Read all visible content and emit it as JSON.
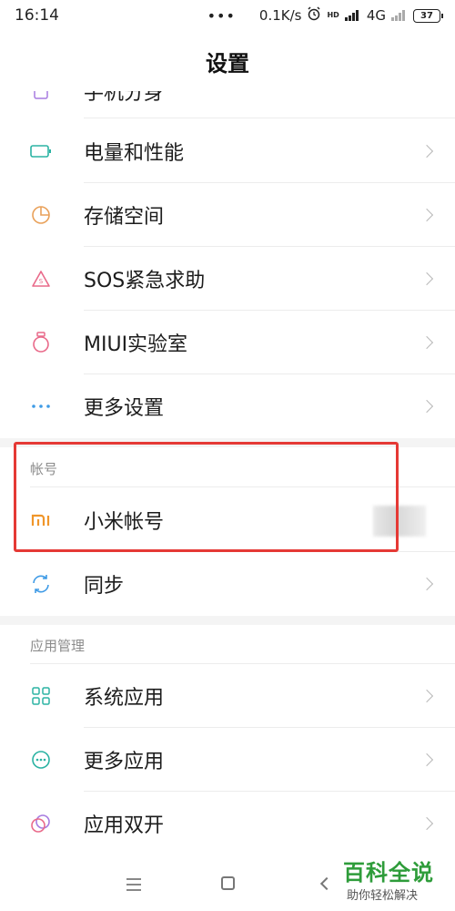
{
  "status_bar": {
    "time": "16:14",
    "dots": "•••",
    "net_speed": "0.1K/s",
    "alarm_icon": "alarm-icon",
    "hd_label": "HD",
    "network": "4G",
    "battery": "37"
  },
  "header": {
    "title": "设置"
  },
  "partial_item": {
    "label": "手机分身",
    "icon": "dual-phone-icon"
  },
  "items_top": [
    {
      "label": "电量和性能",
      "icon": "battery-icon",
      "color": "#2bb3a3"
    },
    {
      "label": "存储空间",
      "icon": "storage-pie-icon",
      "color": "#e9a15a"
    },
    {
      "label": "SOS紧急求助",
      "icon": "sos-icon",
      "color": "#e96a8a"
    },
    {
      "label": "MIUI实验室",
      "icon": "lab-flask-icon",
      "color": "#e96a8a"
    },
    {
      "label": "更多设置",
      "icon": "more-dots-icon",
      "color": "#3f9be6"
    }
  ],
  "account_section": {
    "header": "帐号",
    "items": [
      {
        "label": "小米帐号",
        "icon": "mi-logo-icon",
        "color": "#f0962a"
      },
      {
        "label": "同步",
        "icon": "sync-icon",
        "color": "#3f9be6"
      }
    ]
  },
  "apps_section": {
    "header": "应用管理",
    "items": [
      {
        "label": "系统应用",
        "icon": "grid-apps-icon",
        "color": "#2bb3a3"
      },
      {
        "label": "更多应用",
        "icon": "more-apps-icon",
        "color": "#2bb3a3"
      },
      {
        "label": "应用双开",
        "icon": "dual-apps-icon",
        "color": "#a77be0"
      }
    ]
  },
  "watermark": {
    "title": "百科全说",
    "subtitle": "助你轻松解决"
  },
  "colors": {
    "highlight": "#e53935",
    "brand_green": "#2e9c3a"
  }
}
